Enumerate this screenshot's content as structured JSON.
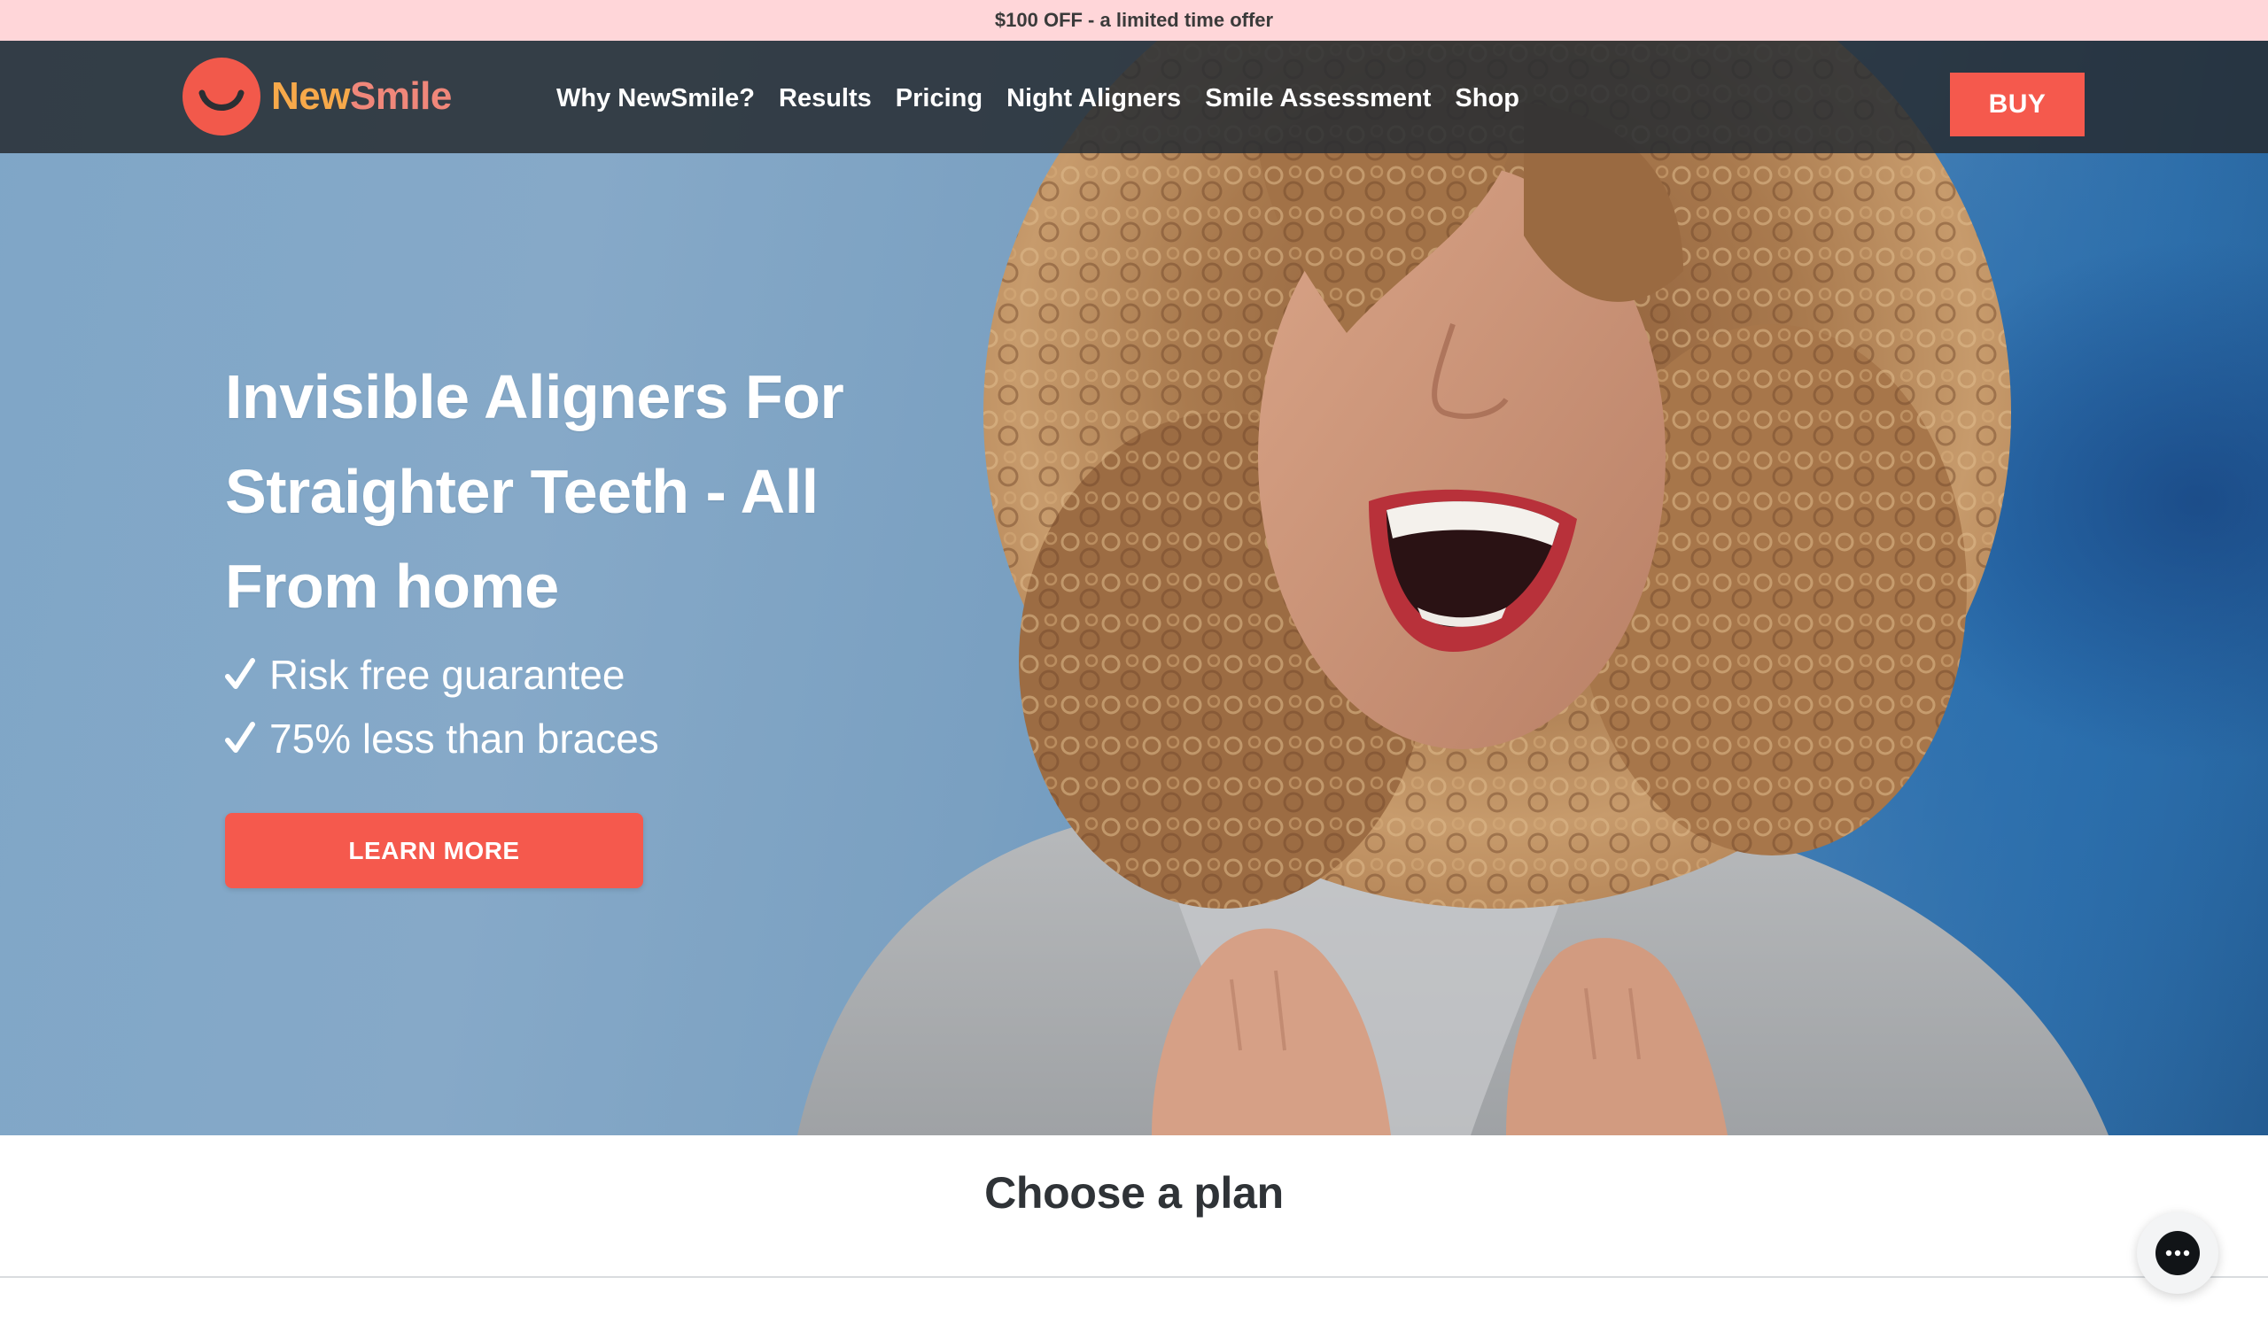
{
  "promo": {
    "text": "$100 OFF - a limited time offer"
  },
  "brand": {
    "name_part1": "NewSmile",
    "name_part1_short": "New",
    "name_part2": "Smile",
    "logo_icon": "smile-logo-icon"
  },
  "nav": {
    "items": [
      {
        "label": "Why NewSmile?"
      },
      {
        "label": "Results"
      },
      {
        "label": "Pricing"
      },
      {
        "label": "Night Aligners"
      },
      {
        "label": "Smile Assessment"
      },
      {
        "label": "Shop"
      }
    ],
    "buy_label": "BUY"
  },
  "hero": {
    "headline": "Invisible Aligners For Straighter Teeth - All From home",
    "benefits": [
      {
        "text": "Risk free guarantee",
        "icon": "check-icon"
      },
      {
        "text": "75% less than braces",
        "icon": "check-icon"
      }
    ],
    "cta_label": "LEARN MORE"
  },
  "plans": {
    "title": "Choose a plan"
  },
  "chat": {
    "icon": "chat-bubble-icon"
  },
  "colors": {
    "accent": "#f5594d",
    "promo_bg": "#ffd6d9",
    "nav_bg": "#262c32",
    "logo_orange": "#f7a94a",
    "logo_coral": "#f0877a"
  }
}
